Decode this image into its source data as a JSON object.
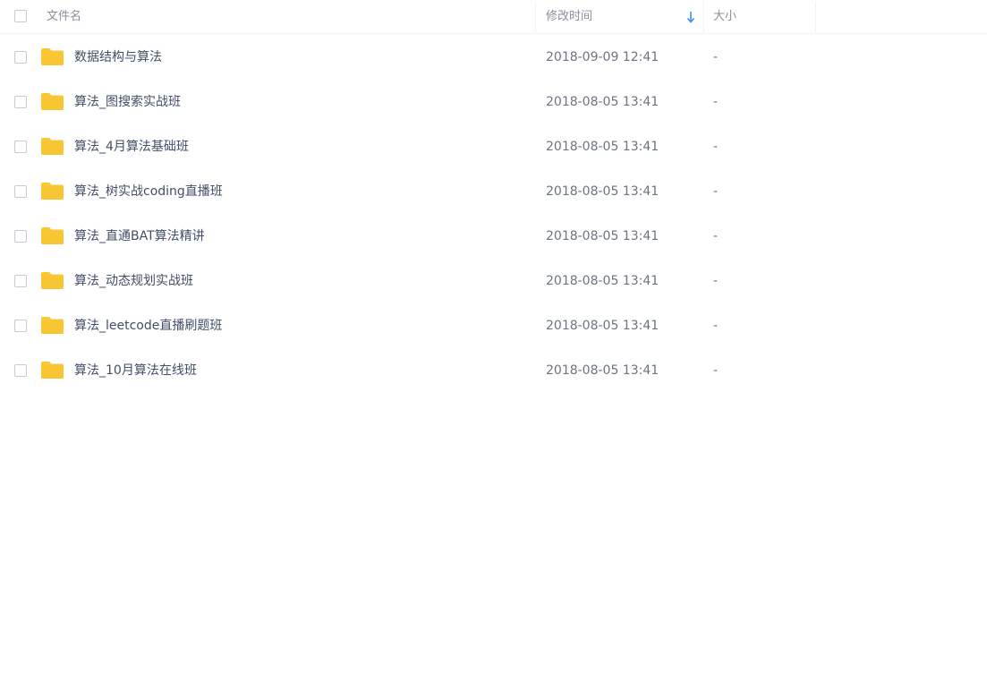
{
  "header": {
    "name_label": "文件名",
    "mtime_label": "修改时间",
    "size_label": "大小",
    "sort_icon": "arrow-down-icon",
    "sort_color": "#3b8cff"
  },
  "folder_color": "#f9c634",
  "rows": [
    {
      "name": "数据结构与算法",
      "mtime": "2018-09-09 12:41",
      "size": "-"
    },
    {
      "name": "算法_图搜索实战班",
      "mtime": "2018-08-05 13:41",
      "size": "-"
    },
    {
      "name": "算法_4月算法基础班",
      "mtime": "2018-08-05 13:41",
      "size": "-"
    },
    {
      "name": "算法_树实战coding直播班",
      "mtime": "2018-08-05 13:41",
      "size": "-"
    },
    {
      "name": "算法_直通BAT算法精讲",
      "mtime": "2018-08-05 13:41",
      "size": "-"
    },
    {
      "name": "算法_动态规划实战班",
      "mtime": "2018-08-05 13:41",
      "size": "-"
    },
    {
      "name": "算法_leetcode直播刷题班",
      "mtime": "2018-08-05 13:41",
      "size": "-"
    },
    {
      "name": "算法_10月算法在线班",
      "mtime": "2018-08-05 13:41",
      "size": "-"
    }
  ]
}
